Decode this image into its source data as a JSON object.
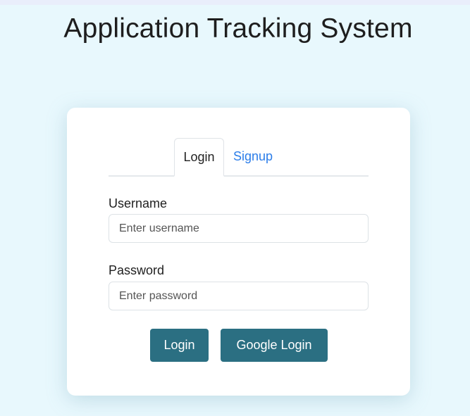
{
  "page": {
    "title": "Application Tracking System"
  },
  "tabs": [
    {
      "label": "Login",
      "active": true
    },
    {
      "label": "Signup",
      "active": false
    }
  ],
  "form": {
    "username": {
      "label": "Username",
      "value": "",
      "placeholder": "Enter username"
    },
    "password": {
      "label": "Password",
      "value": "",
      "placeholder": "Enter password"
    }
  },
  "buttons": {
    "login_label": "Login",
    "google_login_label": "Google Login"
  },
  "colors": {
    "page_background": "#e8f8fd",
    "card_background": "#ffffff",
    "button_background": "#2b6f82",
    "tab_link": "#2b7de9"
  }
}
